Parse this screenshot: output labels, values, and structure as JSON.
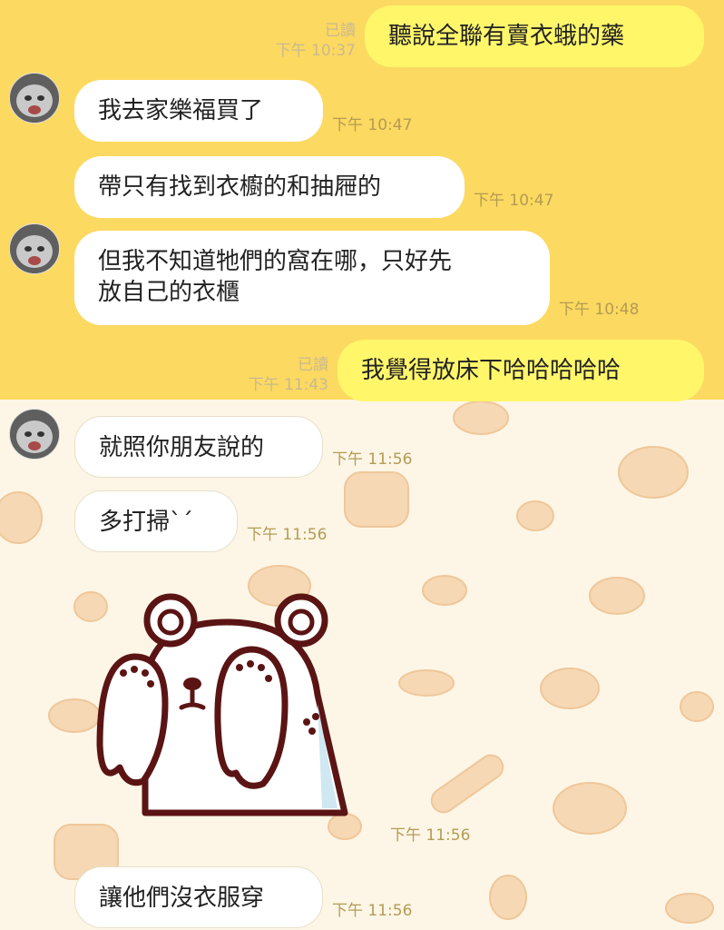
{
  "messages": [
    {
      "side": "out",
      "text": "聽說全聯有賣衣蛾的藥",
      "read": "已讀",
      "time": "下午 10:37"
    },
    {
      "side": "in",
      "text": "我去家樂福買了",
      "time": "下午 10:47"
    },
    {
      "side": "in",
      "text": "帶只有找到衣櫥的和抽屜的",
      "time": "下午 10:47"
    },
    {
      "side": "in",
      "text_line1": "但我不知道牠們的窩在哪，只好先",
      "text_line2": "放自己的衣櫃",
      "time": "下午 10:48"
    },
    {
      "side": "out",
      "text": "我覺得放床下哈哈哈哈哈",
      "read": "已讀",
      "time": "下午 11:43"
    },
    {
      "side": "in",
      "text": "就照你朋友說的",
      "time": "下午 11:56"
    },
    {
      "side": "in",
      "text": "多打掃`´",
      "time": "下午 11:56"
    },
    {
      "side": "in",
      "sticker": "bear-covering-face-sticker",
      "time": "下午 11:56"
    },
    {
      "side": "in",
      "text": "讓他們沒衣服穿",
      "time": "下午 11:56"
    }
  ],
  "colors": {
    "top_bg": "#fcd960",
    "bottom_bg": "#fdf6e6",
    "out_bubble": "#fff66a",
    "in_bubble": "#ffffff"
  }
}
